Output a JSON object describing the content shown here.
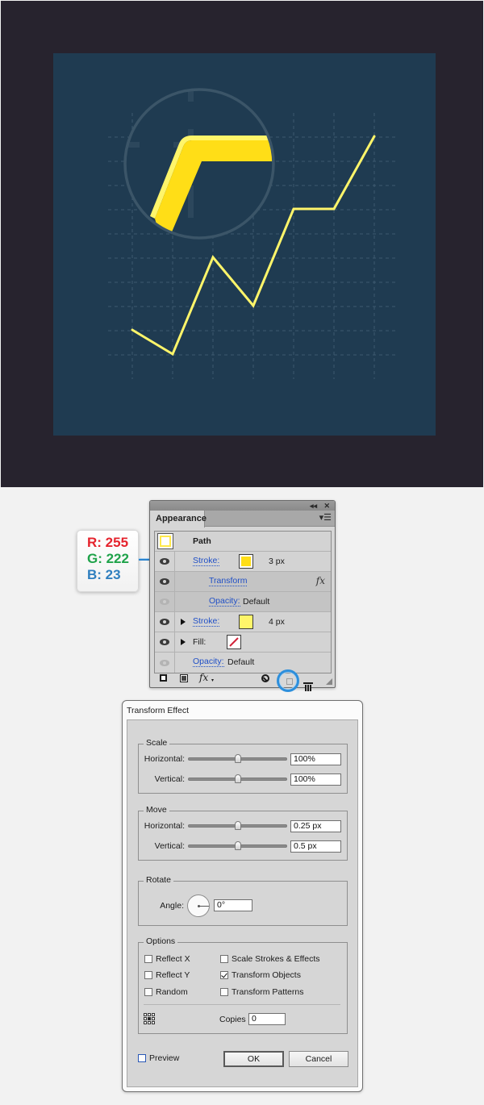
{
  "artboard": {
    "colors": {
      "frame": "#27232e",
      "canvas": "#1f3b51",
      "grid": "#3e5a70",
      "line": "#fff56a",
      "magnifier_ring": "#3b5568",
      "magnified_stroke_main": "#ffde17",
      "magnified_stroke_highlight": "#fff56a"
    },
    "zigzag_line": {
      "description": "Yellow polyline over a dashed grid, points in grid cells (col, row from top)",
      "points": [
        [
          0,
          9
        ],
        [
          1,
          10
        ],
        [
          2,
          6
        ],
        [
          3,
          8
        ],
        [
          4,
          4
        ],
        [
          5,
          4
        ],
        [
          6,
          1
        ]
      ]
    },
    "grid": {
      "columns": 7,
      "rows": 10
    }
  },
  "rgb_callout": {
    "r_label": "R: 255",
    "g_label": "G: 222",
    "b_label": "B: 23",
    "r_color": "#e5232d",
    "g_color": "#1fa34a",
    "b_color": "#2f7fbf"
  },
  "appearance_panel": {
    "tab_label": "Appearance",
    "collapse_glyph": "◂◂",
    "close_glyph": "✕",
    "menu_glyph": "▾☰",
    "rows": [
      {
        "type": "object",
        "label": "Path",
        "swatch_color": "#ffffff"
      },
      {
        "type": "attribute",
        "label": "Stroke:",
        "swatch_color": "#ffde17",
        "value": "3 px",
        "visible": true,
        "selected": true
      },
      {
        "type": "effect",
        "label": "Transform",
        "fx": "fx",
        "visible": true
      },
      {
        "type": "sub",
        "label": "Opacity:",
        "value": "Default",
        "visible": false
      },
      {
        "type": "attribute",
        "label": "Stroke:",
        "swatch_color": "#fff56a",
        "value": "4 px",
        "visible": true,
        "expandable": true
      },
      {
        "type": "attribute",
        "label": "Fill:",
        "swatch": "none",
        "visible": true,
        "expandable": true
      },
      {
        "type": "attribute",
        "label": "Opacity:",
        "value": "Default",
        "visible": false
      }
    ],
    "footer": {
      "add_stroke": "add-new-stroke",
      "add_fill": "add-new-fill",
      "fx_label": "fx",
      "clear": "clear-appearance",
      "duplicate": "duplicate-selected-item",
      "delete": "delete-selected-item",
      "highlighted": "duplicate-selected-item"
    }
  },
  "transform_dialog": {
    "title": "Transform Effect",
    "scale": {
      "label": "Scale",
      "horizontal_label": "Horizontal:",
      "horizontal_value": "100%",
      "horizontal_slider": 0.5,
      "vertical_label": "Vertical:",
      "vertical_value": "100%",
      "vertical_slider": 0.5
    },
    "move": {
      "label": "Move",
      "horizontal_label": "Horizontal:",
      "horizontal_value": "0.25 px",
      "horizontal_slider": 0.5,
      "vertical_label": "Vertical:",
      "vertical_value": "0.5 px",
      "vertical_slider": 0.5
    },
    "rotate": {
      "label": "Rotate",
      "angle_label": "Angle:",
      "angle_value": "0°"
    },
    "options": {
      "label": "Options",
      "reflect_x": {
        "label": "Reflect X",
        "checked": false
      },
      "reflect_y": {
        "label": "Reflect Y",
        "checked": false
      },
      "random": {
        "label": "Random",
        "checked": false
      },
      "scale_strokes": {
        "label": "Scale Strokes & Effects",
        "checked": false
      },
      "transform_objects": {
        "label": "Transform Objects",
        "checked": true
      },
      "transform_patterns": {
        "label": "Transform Patterns",
        "checked": false
      },
      "copies_label": "Copies",
      "copies_value": "0",
      "reference_point": "center"
    },
    "preview": {
      "label": "Preview",
      "checked": false
    },
    "ok_label": "OK",
    "cancel_label": "Cancel"
  }
}
